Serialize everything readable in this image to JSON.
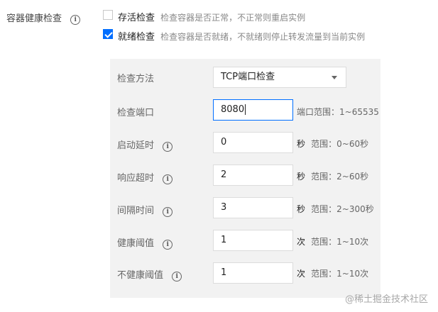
{
  "section_label": "容器健康检查",
  "liveness": {
    "label": "存活检查",
    "description": "检查容器是否正常，不正常则重启实例",
    "checked": false
  },
  "readiness": {
    "label": "就绪检查",
    "description": "检查容器是否就绪，不就绪则停止转发流量到当前实例",
    "checked": true
  },
  "form": {
    "method": {
      "label": "检查方法",
      "value": "TCP端口检查"
    },
    "port": {
      "label": "检查端口",
      "value": "8080",
      "hint": "端口范围：1~65535"
    },
    "initial_delay": {
      "label": "启动延时",
      "value": "0",
      "unit": "秒",
      "hint": "范围：0~60秒"
    },
    "timeout": {
      "label": "响应超时",
      "value": "2",
      "unit": "秒",
      "hint": "范围：2~60秒"
    },
    "period": {
      "label": "间隔时间",
      "value": "3",
      "unit": "秒",
      "hint": "范围：2~300秒"
    },
    "healthy_threshold": {
      "label": "健康阈值",
      "value": "1",
      "unit": "次",
      "hint": "范围：1~10次"
    },
    "unhealthy_threshold": {
      "label": "不健康阈值",
      "value": "1",
      "unit": "次",
      "hint": "范围：1~10次"
    }
  },
  "icons": {
    "info": "i",
    "caret": "chevron-down-icon",
    "checkmark": "check-icon"
  },
  "colors": {
    "accent": "#006eff",
    "panel_bg": "#f2f2f2"
  },
  "watermark": "@稀土掘金技术社区"
}
